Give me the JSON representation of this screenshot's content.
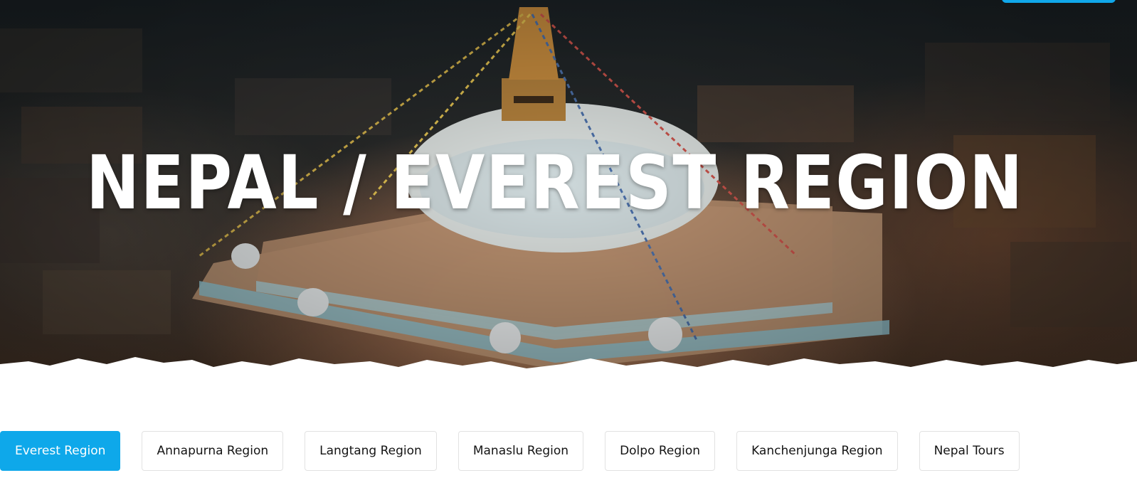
{
  "hero": {
    "title": "NEPAL / EVEREST REGION",
    "background": "aerial-stupa-image"
  },
  "region_tabs": [
    {
      "label": "Everest Region",
      "active": true
    },
    {
      "label": "Annapurna Region",
      "active": false
    },
    {
      "label": "Langtang Region",
      "active": false
    },
    {
      "label": "Manaslu Region",
      "active": false
    },
    {
      "label": "Dolpo Region",
      "active": false
    },
    {
      "label": "Kanchenjunga Region",
      "active": false
    },
    {
      "label": "Nepal Tours",
      "active": false
    }
  ],
  "colors": {
    "accent": "#0ea8ea",
    "tab_border": "#e2e2e2",
    "title": "#ffffff"
  }
}
